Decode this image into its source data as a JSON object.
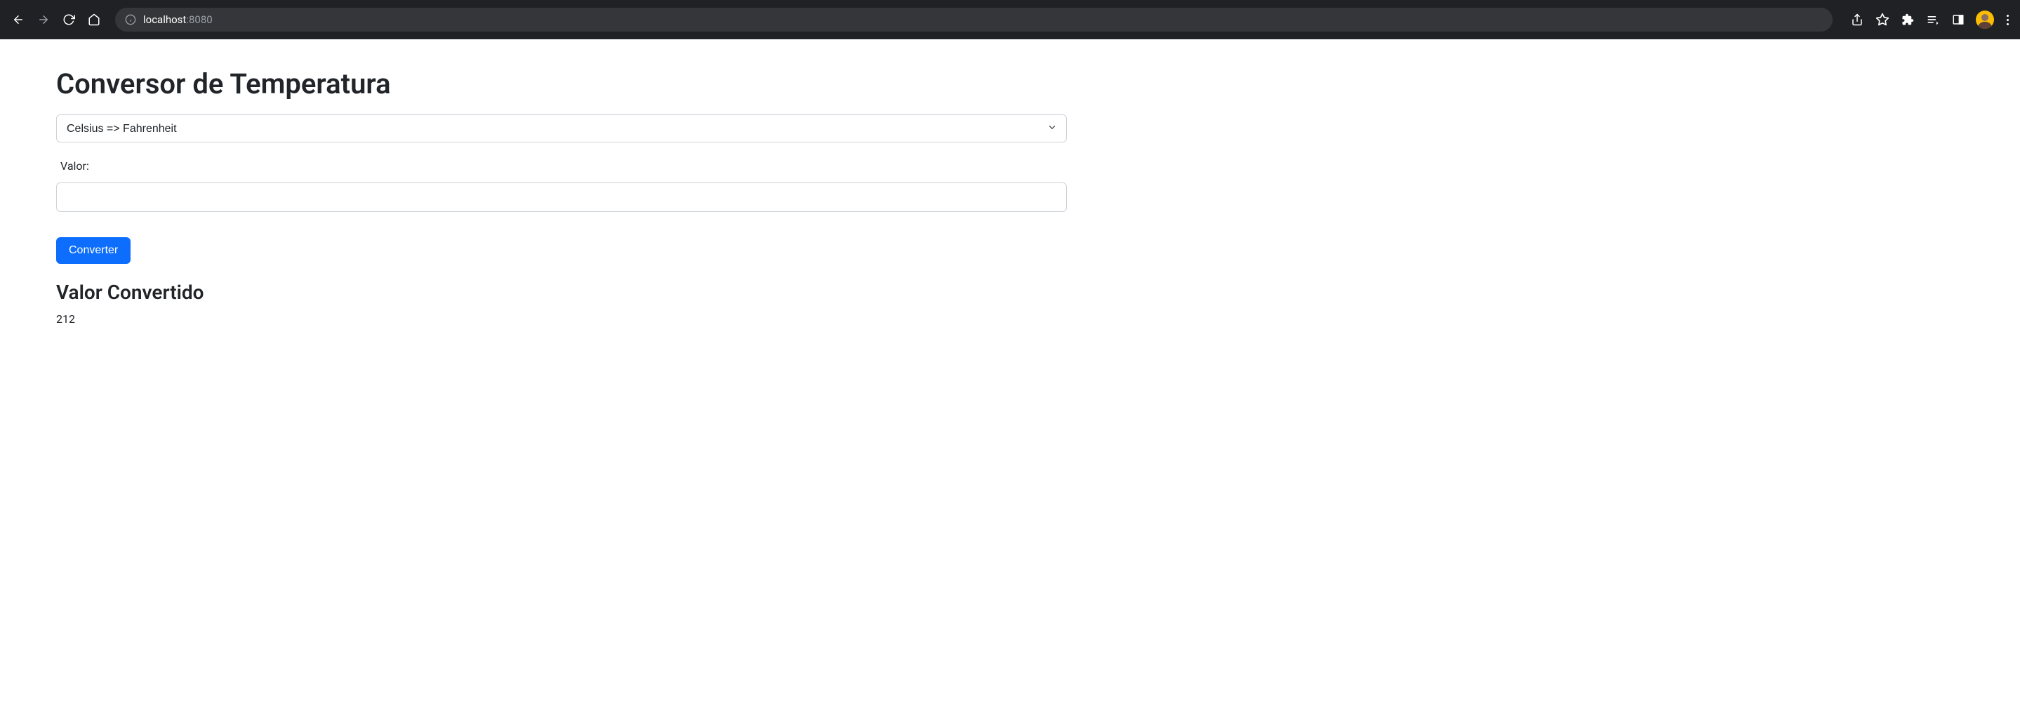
{
  "browser": {
    "url_host": "localhost",
    "url_port": ":8080"
  },
  "page": {
    "title": "Conversor de Temperatura",
    "select": {
      "selected": "Celsius => Fahrenheit"
    },
    "input": {
      "label": "Valor:",
      "value": ""
    },
    "button": {
      "label": "Converter"
    },
    "result": {
      "heading": "Valor Convertido",
      "value": "212"
    }
  }
}
